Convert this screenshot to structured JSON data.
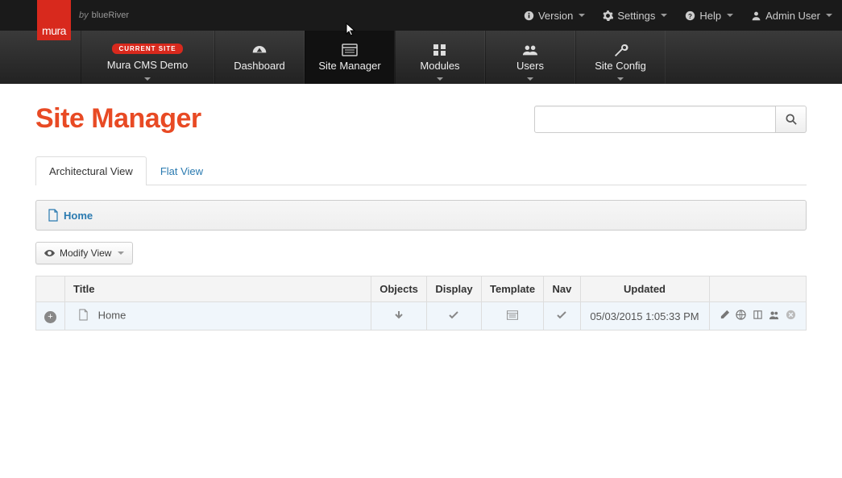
{
  "brand": {
    "logo_text": "mura",
    "by": "by",
    "company": "blueRiver"
  },
  "top_menu": {
    "version": "Version",
    "settings": "Settings",
    "help": "Help",
    "admin": "Admin User"
  },
  "nav": {
    "current_site_badge": "CURRENT SITE",
    "current_site_name": "Mura CMS Demo",
    "dashboard": "Dashboard",
    "site_manager": "Site Manager",
    "modules": "Modules",
    "users": "Users",
    "site_config": "Site Config"
  },
  "page": {
    "title": "Site Manager",
    "tabs": {
      "architectural": "Architectural View",
      "flat": "Flat View"
    },
    "breadcrumb_home": "Home",
    "modify_view": "Modify View",
    "search_placeholder": ""
  },
  "table": {
    "headers": {
      "title": "Title",
      "objects": "Objects",
      "display": "Display",
      "template": "Template",
      "nav": "Nav",
      "updated": "Updated"
    },
    "rows": [
      {
        "title": "Home",
        "updated": "05/03/2015 1:05:33 PM"
      }
    ]
  }
}
